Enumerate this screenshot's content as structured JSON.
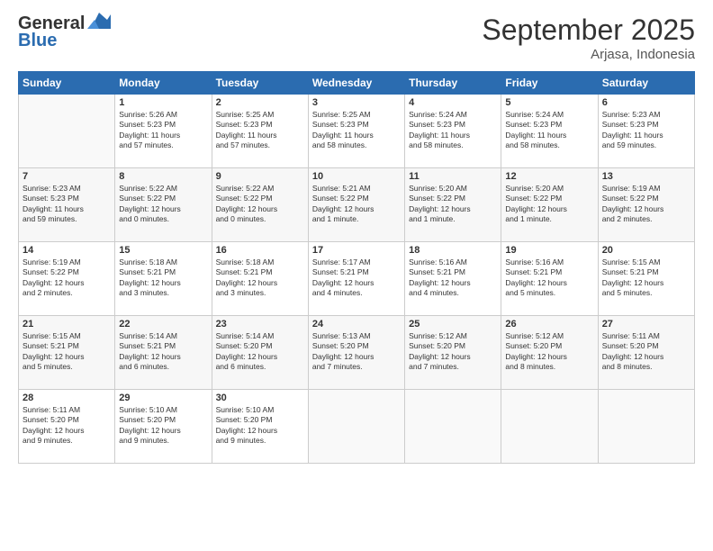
{
  "header": {
    "logo_line1": "General",
    "logo_line2": "Blue",
    "month": "September 2025",
    "location": "Arjasa, Indonesia"
  },
  "days_of_week": [
    "Sunday",
    "Monday",
    "Tuesday",
    "Wednesday",
    "Thursday",
    "Friday",
    "Saturday"
  ],
  "weeks": [
    [
      {
        "day": "",
        "info": ""
      },
      {
        "day": "1",
        "info": "Sunrise: 5:26 AM\nSunset: 5:23 PM\nDaylight: 11 hours\nand 57 minutes."
      },
      {
        "day": "2",
        "info": "Sunrise: 5:25 AM\nSunset: 5:23 PM\nDaylight: 11 hours\nand 57 minutes."
      },
      {
        "day": "3",
        "info": "Sunrise: 5:25 AM\nSunset: 5:23 PM\nDaylight: 11 hours\nand 58 minutes."
      },
      {
        "day": "4",
        "info": "Sunrise: 5:24 AM\nSunset: 5:23 PM\nDaylight: 11 hours\nand 58 minutes."
      },
      {
        "day": "5",
        "info": "Sunrise: 5:24 AM\nSunset: 5:23 PM\nDaylight: 11 hours\nand 58 minutes."
      },
      {
        "day": "6",
        "info": "Sunrise: 5:23 AM\nSunset: 5:23 PM\nDaylight: 11 hours\nand 59 minutes."
      }
    ],
    [
      {
        "day": "7",
        "info": "Sunrise: 5:23 AM\nSunset: 5:23 PM\nDaylight: 11 hours\nand 59 minutes."
      },
      {
        "day": "8",
        "info": "Sunrise: 5:22 AM\nSunset: 5:22 PM\nDaylight: 12 hours\nand 0 minutes."
      },
      {
        "day": "9",
        "info": "Sunrise: 5:22 AM\nSunset: 5:22 PM\nDaylight: 12 hours\nand 0 minutes."
      },
      {
        "day": "10",
        "info": "Sunrise: 5:21 AM\nSunset: 5:22 PM\nDaylight: 12 hours\nand 1 minute."
      },
      {
        "day": "11",
        "info": "Sunrise: 5:20 AM\nSunset: 5:22 PM\nDaylight: 12 hours\nand 1 minute."
      },
      {
        "day": "12",
        "info": "Sunrise: 5:20 AM\nSunset: 5:22 PM\nDaylight: 12 hours\nand 1 minute."
      },
      {
        "day": "13",
        "info": "Sunrise: 5:19 AM\nSunset: 5:22 PM\nDaylight: 12 hours\nand 2 minutes."
      }
    ],
    [
      {
        "day": "14",
        "info": "Sunrise: 5:19 AM\nSunset: 5:22 PM\nDaylight: 12 hours\nand 2 minutes."
      },
      {
        "day": "15",
        "info": "Sunrise: 5:18 AM\nSunset: 5:21 PM\nDaylight: 12 hours\nand 3 minutes."
      },
      {
        "day": "16",
        "info": "Sunrise: 5:18 AM\nSunset: 5:21 PM\nDaylight: 12 hours\nand 3 minutes."
      },
      {
        "day": "17",
        "info": "Sunrise: 5:17 AM\nSunset: 5:21 PM\nDaylight: 12 hours\nand 4 minutes."
      },
      {
        "day": "18",
        "info": "Sunrise: 5:16 AM\nSunset: 5:21 PM\nDaylight: 12 hours\nand 4 minutes."
      },
      {
        "day": "19",
        "info": "Sunrise: 5:16 AM\nSunset: 5:21 PM\nDaylight: 12 hours\nand 5 minutes."
      },
      {
        "day": "20",
        "info": "Sunrise: 5:15 AM\nSunset: 5:21 PM\nDaylight: 12 hours\nand 5 minutes."
      }
    ],
    [
      {
        "day": "21",
        "info": "Sunrise: 5:15 AM\nSunset: 5:21 PM\nDaylight: 12 hours\nand 5 minutes."
      },
      {
        "day": "22",
        "info": "Sunrise: 5:14 AM\nSunset: 5:21 PM\nDaylight: 12 hours\nand 6 minutes."
      },
      {
        "day": "23",
        "info": "Sunrise: 5:14 AM\nSunset: 5:20 PM\nDaylight: 12 hours\nand 6 minutes."
      },
      {
        "day": "24",
        "info": "Sunrise: 5:13 AM\nSunset: 5:20 PM\nDaylight: 12 hours\nand 7 minutes."
      },
      {
        "day": "25",
        "info": "Sunrise: 5:12 AM\nSunset: 5:20 PM\nDaylight: 12 hours\nand 7 minutes."
      },
      {
        "day": "26",
        "info": "Sunrise: 5:12 AM\nSunset: 5:20 PM\nDaylight: 12 hours\nand 8 minutes."
      },
      {
        "day": "27",
        "info": "Sunrise: 5:11 AM\nSunset: 5:20 PM\nDaylight: 12 hours\nand 8 minutes."
      }
    ],
    [
      {
        "day": "28",
        "info": "Sunrise: 5:11 AM\nSunset: 5:20 PM\nDaylight: 12 hours\nand 9 minutes."
      },
      {
        "day": "29",
        "info": "Sunrise: 5:10 AM\nSunset: 5:20 PM\nDaylight: 12 hours\nand 9 minutes."
      },
      {
        "day": "30",
        "info": "Sunrise: 5:10 AM\nSunset: 5:20 PM\nDaylight: 12 hours\nand 9 minutes."
      },
      {
        "day": "",
        "info": ""
      },
      {
        "day": "",
        "info": ""
      },
      {
        "day": "",
        "info": ""
      },
      {
        "day": "",
        "info": ""
      }
    ]
  ]
}
